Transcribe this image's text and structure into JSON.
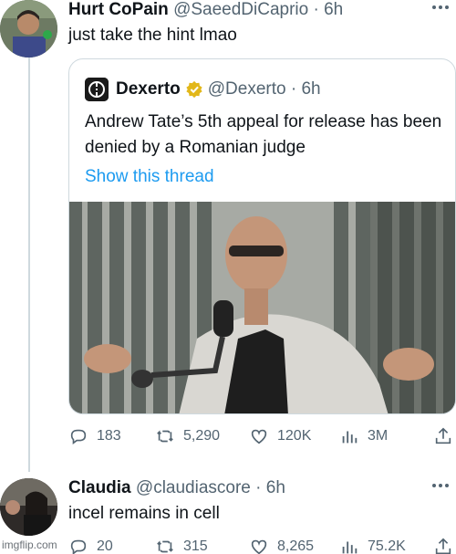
{
  "tweet1": {
    "name": "Hurt CoPain",
    "handle": "@SaeedDiCaprio · 6h",
    "text": "just take the hint lmao"
  },
  "quote": {
    "name": "Dexerto",
    "handle": "@Dexerto · 6h",
    "text": "Andrew Tate’s 5th appeal for release has been denied by a Romanian judge",
    "show_thread": "Show this thread"
  },
  "tweet1_actions": {
    "replies": "183",
    "retweets": "5,290",
    "likes": "120K",
    "views": "3M"
  },
  "tweet2": {
    "name": "Claudia",
    "handle": "@claudiascore · 6h",
    "text": "incel remains in cell"
  },
  "tweet2_actions": {
    "replies": "20",
    "retweets": "315",
    "likes": "8,265",
    "views": "75.2K"
  },
  "watermark": "imgflip.com",
  "colors": {
    "link": "#1d9bf0",
    "secondary_text": "#536471",
    "border": "#cfd9de",
    "verified_gold": "#e2b719"
  },
  "icons": [
    "reply-icon",
    "retweet-icon",
    "like-icon",
    "views-icon",
    "share-icon",
    "verified-icon",
    "more-icon"
  ]
}
